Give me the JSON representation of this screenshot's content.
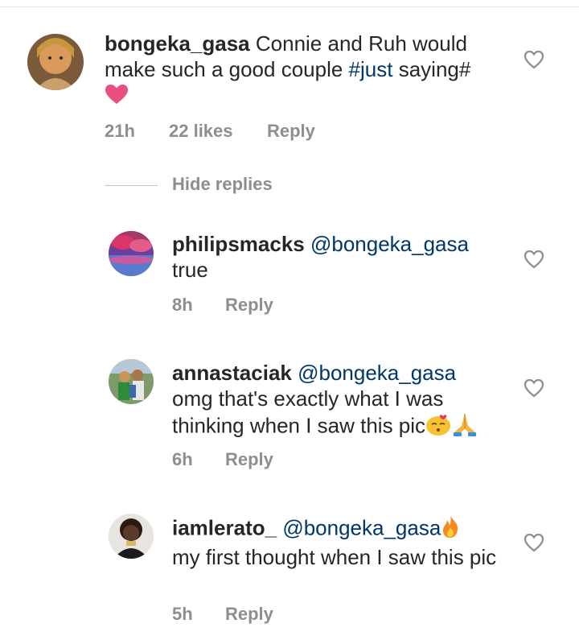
{
  "comment": {
    "username": "bongeka_gasa",
    "text": "Connie and Ruh would make such a good couple",
    "hashtag": "#just",
    "text_after": "saying#",
    "emoji": "pink-heart",
    "time": "21h",
    "likes": "22 likes",
    "reply_label": "Reply"
  },
  "hide_replies": "Hide replies",
  "replies": [
    {
      "username": "philipsmacks",
      "mention": "@bongeka_gasa",
      "text": "true",
      "time": "8h",
      "reply_label": "Reply"
    },
    {
      "username": "annastaciak",
      "mention": "@bongeka_gasa",
      "text": "omg that's exactly what I was thinking when I saw this pic",
      "emojis": [
        "kissing-face",
        "folded-hands"
      ],
      "time": "6h",
      "reply_label": "Reply"
    },
    {
      "username": "iamlerato_",
      "mention": "@bongeka_gasa",
      "mention_emoji": "fire",
      "text": "my first thought when I saw this pic",
      "time": "5h",
      "reply_label": "Reply"
    }
  ],
  "colors": {
    "link": "#00376b",
    "meta": "#8e8e8e",
    "heart_emoji": "#ec4e7d",
    "fire": "#f5891f"
  }
}
